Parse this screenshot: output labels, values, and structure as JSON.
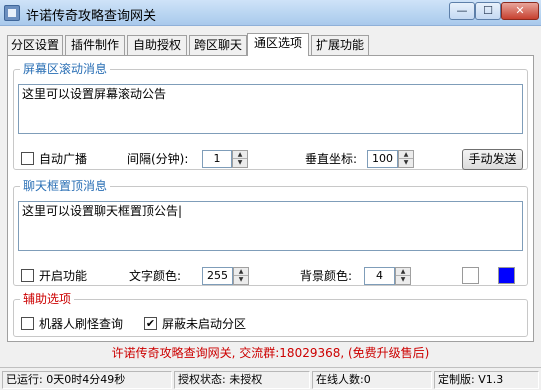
{
  "window": {
    "title": "许诺传奇攻略查询网关",
    "minimize_label": "—",
    "maximize_label": "☐",
    "close_label": "✕",
    "icon": "app-icon"
  },
  "tabs": [
    {
      "label": "分区设置",
      "active": false
    },
    {
      "label": "插件制作",
      "active": false
    },
    {
      "label": "自助授权",
      "active": false
    },
    {
      "label": "跨区聊天",
      "active": false
    },
    {
      "label": "通区选项",
      "active": true
    },
    {
      "label": "扩展功能",
      "active": false
    }
  ],
  "scroll_group": {
    "title": "屏幕区滚动消息",
    "text": "这里可以设置屏幕滚动公告",
    "auto_broadcast_label": "自动广播",
    "auto_broadcast_checked": false,
    "interval_label": "间隔(分钟):",
    "interval_value": "1",
    "vertical_label": "垂直坐标:",
    "vertical_value": "100",
    "send_button": "手动发送"
  },
  "chat_group": {
    "title": "聊天框置顶消息",
    "text": "这里可以设置聊天框置顶公告|",
    "enable_label": "开启功能",
    "enable_checked": false,
    "text_color_label": "文字颜色:",
    "text_color_value": "255",
    "bg_color_label": "背景颜色:",
    "bg_color_value": "4",
    "swatch_colors": [
      "#ffffff",
      "#0000ff"
    ]
  },
  "aux_group": {
    "title": "辅助选项",
    "robot_label": "机器人刷怪查询",
    "robot_checked": false,
    "block_label": "屏蔽未启动分区",
    "block_checked": true,
    "check_mark": "✔"
  },
  "footer_info": "许诺传奇攻略查询网关, 交流群:18029368, (免费升级售后)",
  "status": {
    "running": "已运行: 0天0时4分49秒",
    "auth": "授权状态: 未授权",
    "online": "在线人数:0",
    "version": "定制版: V1.3"
  }
}
